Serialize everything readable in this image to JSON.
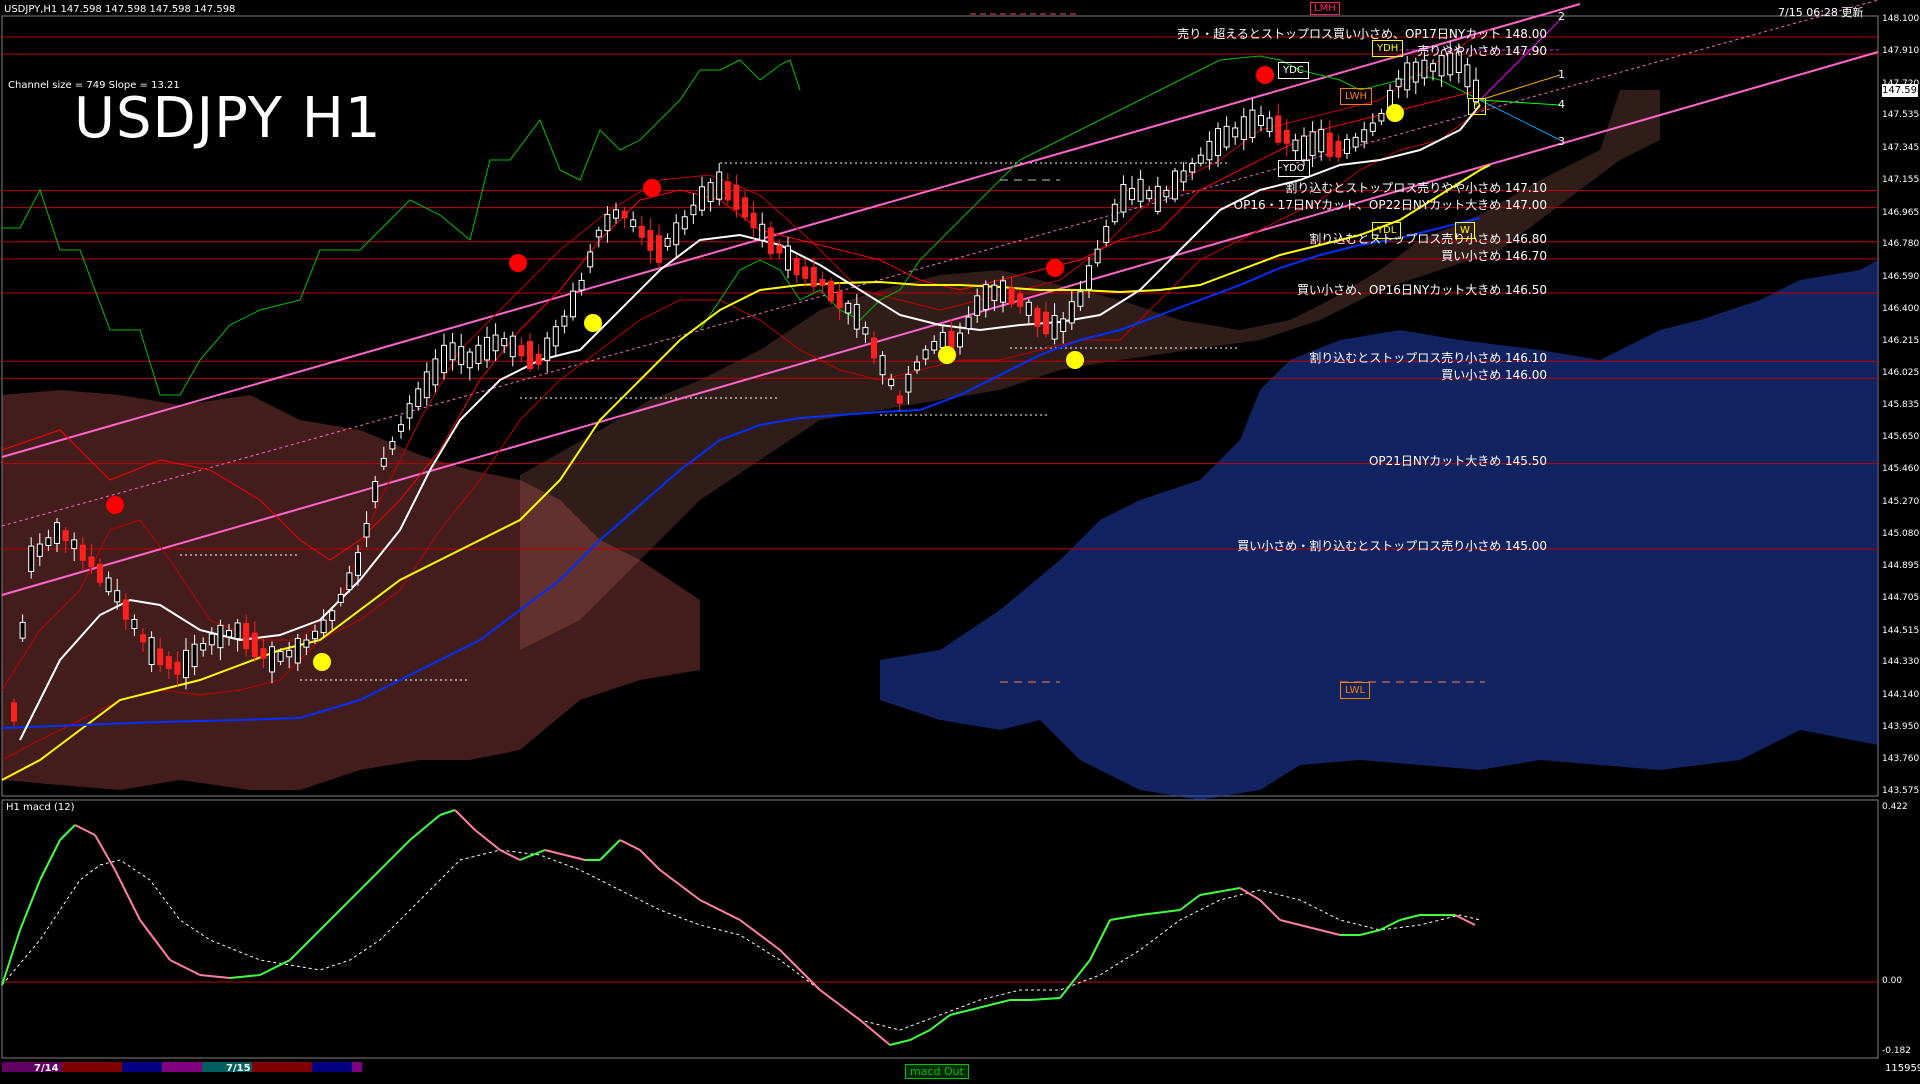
{
  "header": {
    "symbol_line": "USDJPY,H1  147.598 147.598 147.598 147.598",
    "timestamp": "7/15 06:28 更新",
    "channel_info": "Channel size = 749 Slope = 13.21",
    "big_title": "USDJPY H1",
    "subwindow_label": "H1  macd (12)",
    "macd_button": "macd Out",
    "bottom_number": "115959"
  },
  "colors": {
    "background": "#000000",
    "bull_candle": "#ffffff",
    "bear_candle": "#ff2020",
    "level_line": "#c00000",
    "channel": "#ff66cc",
    "ma_fast": "#ffffff",
    "ma_mid": "#ffff00",
    "ma_slow": "#0030ff",
    "cloud_up": "#3050c8",
    "cloud_down": "#c05050",
    "macd_up": "#40ff40",
    "macd_down": "#ff80a0"
  },
  "price_axis": {
    "current": "147.598",
    "ticks": [
      "148.100",
      "147.910",
      "147.720",
      "147.535",
      "147.345",
      "147.155",
      "146.965",
      "146.780",
      "146.590",
      "146.400",
      "146.215",
      "146.025",
      "145.835",
      "145.650",
      "145.460",
      "145.270",
      "145.080",
      "144.895",
      "144.705",
      "144.515",
      "144.330",
      "144.140",
      "143.950",
      "143.760",
      "143.575"
    ],
    "macd_ticks": [
      "0.422",
      "0.00",
      "-0.182"
    ]
  },
  "levels": [
    {
      "price": 148.0,
      "text": "売り・超えるとストップロス買い小さめ、OP17日NYカット 148.00"
    },
    {
      "price": 147.9,
      "text": "売りやや小さめ 147.90"
    },
    {
      "price": 147.1,
      "text": "割り込むとストップロス売りやや小さめ 147.10"
    },
    {
      "price": 147.0,
      "text": "OP16・17日NYカット、OP22日NYカット大きめ 147.00"
    },
    {
      "price": 146.8,
      "text": "割り込むとストップロス売り小さめ 146.80"
    },
    {
      "price": 146.7,
      "text": "買い小さめ 146.70"
    },
    {
      "price": 146.5,
      "text": "買い小さめ、OP16日NYカット大きめ 146.50"
    },
    {
      "price": 146.1,
      "text": "割り込むとストップロス売り小さめ 146.10"
    },
    {
      "price": 146.0,
      "text": "買い小さめ 146.00"
    },
    {
      "price": 145.5,
      "text": "OP21日NYカット大きめ 145.50"
    },
    {
      "price": 145.0,
      "text": "買い小さめ・割り込むとストップロス売り小さめ 145.00"
    }
  ],
  "markers": {
    "ydh": "YDH",
    "ydc": "YDC",
    "ydo": "YDO",
    "ydl": "YDL",
    "lwh": "LWH",
    "lwl": "LWL",
    "lmh": "LMH",
    "w": "W",
    "d": "D",
    "fan_labels": [
      "1",
      "2",
      "3",
      "4"
    ]
  },
  "time_axis": {
    "dates": [
      "7/14",
      "7/15"
    ]
  }
}
